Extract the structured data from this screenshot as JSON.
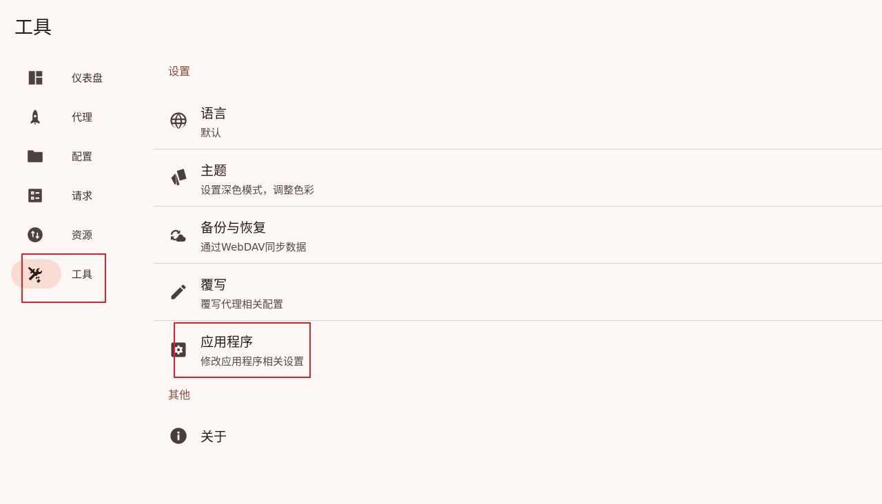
{
  "page": {
    "title": "工具"
  },
  "sidebar": {
    "items": [
      {
        "label": "仪表盘",
        "icon": "dashboard-icon"
      },
      {
        "label": "代理",
        "icon": "rocket-icon"
      },
      {
        "label": "配置",
        "icon": "folder-icon"
      },
      {
        "label": "请求",
        "icon": "list-alt-icon"
      },
      {
        "label": "资源",
        "icon": "swap-vertical-icon"
      },
      {
        "label": "工具",
        "icon": "tools-icon",
        "active": true
      }
    ]
  },
  "main": {
    "sections": [
      {
        "header": "设置",
        "items": [
          {
            "title": "语言",
            "subtitle": "默认",
            "icon": "globe-icon"
          },
          {
            "title": "主题",
            "subtitle": "设置深色模式，调整色彩",
            "icon": "palette-swatch-icon"
          },
          {
            "title": "备份与恢复",
            "subtitle": "通过WebDAV同步数据",
            "icon": "cloud-sync-icon"
          },
          {
            "title": "覆写",
            "subtitle": "覆写代理相关配置",
            "icon": "pencil-icon"
          },
          {
            "title": "应用程序",
            "subtitle": "修改应用程序相关设置",
            "icon": "settings-applications-icon"
          }
        ]
      },
      {
        "header": "其他",
        "items": [
          {
            "title": "关于",
            "icon": "info-icon"
          }
        ]
      }
    ]
  },
  "colors": {
    "background": "#fdf7f5",
    "section_header": "#8c4d3a",
    "active_pill": "#f9dcd2",
    "divider": "#dad0ce",
    "highlight_box": "#e0202a"
  }
}
